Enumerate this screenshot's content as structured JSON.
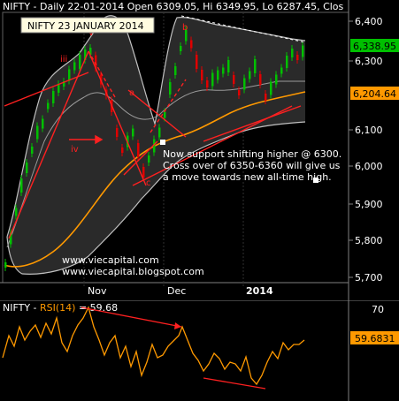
{
  "header": {
    "title": "NIFTY - Daily 22-01-2014 Open 6309.05, Hi 6349.95, Lo 6287.45, Clos"
  },
  "date_box": "NIFTY 23 JANUARY 2014",
  "price_axis": {
    "ticks": [
      "6,400",
      "6,300",
      "6,200",
      "6,100",
      "6,000",
      "5,900",
      "5,800",
      "5,700"
    ],
    "last_price_label": "6,338.95",
    "ma_label": "6,204.64"
  },
  "time_axis": {
    "labels": [
      "Nov",
      "Dec",
      "2014"
    ]
  },
  "wave_labels": [
    "iii",
    "iv",
    "v",
    "a",
    "b",
    "c"
  ],
  "annotation": {
    "line1": "Now support shifting higher @ 6300.",
    "line2": "Cross over of 6350-6360 will give us",
    "line3": "a move towards new all-time high."
  },
  "watermark": {
    "line1": "www.viecapital.com",
    "line2": "www.viecapital.blogspot.com"
  },
  "rsi": {
    "title_prefix": "NIFTY - ",
    "title_indicator": "RSI(14)",
    "title_value": " = 59.68",
    "axis_top": "70",
    "value_label": "59.6831"
  },
  "colors": {
    "background": "#000000",
    "up_candle": "#00c000",
    "down_candle": "#e00000",
    "bands": "#c0c0c0",
    "ma": "#ff9900",
    "trendline": "#ff2020",
    "rsi_line": "#ff9900",
    "last_price_bg": "#00c000",
    "ma_label_bg": "#ff9900"
  }
}
